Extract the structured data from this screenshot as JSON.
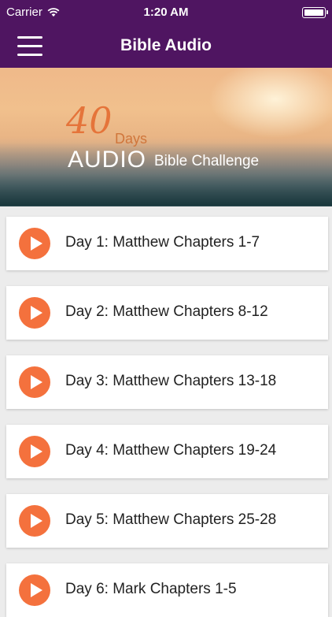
{
  "status_bar": {
    "carrier": "Carrier",
    "time": "1:20 AM"
  },
  "nav": {
    "title": "Bible Audio",
    "menu_icon": "hamburger-menu-icon"
  },
  "banner": {
    "number": "40",
    "days": "Days",
    "audio": "AUDIO",
    "challenge": "Bible Challenge"
  },
  "colors": {
    "nav_bg": "#4f1561",
    "accent": "#f4713d"
  },
  "days": [
    {
      "label": "Day 1: Matthew Chapters 1-7"
    },
    {
      "label": "Day 2: Matthew Chapters 8-12"
    },
    {
      "label": "Day 3: Matthew Chapters 13-18"
    },
    {
      "label": "Day 4: Matthew Chapters 19-24"
    },
    {
      "label": "Day 5: Matthew Chapters 25-28"
    },
    {
      "label": "Day 6: Mark Chapters 1-5"
    }
  ]
}
